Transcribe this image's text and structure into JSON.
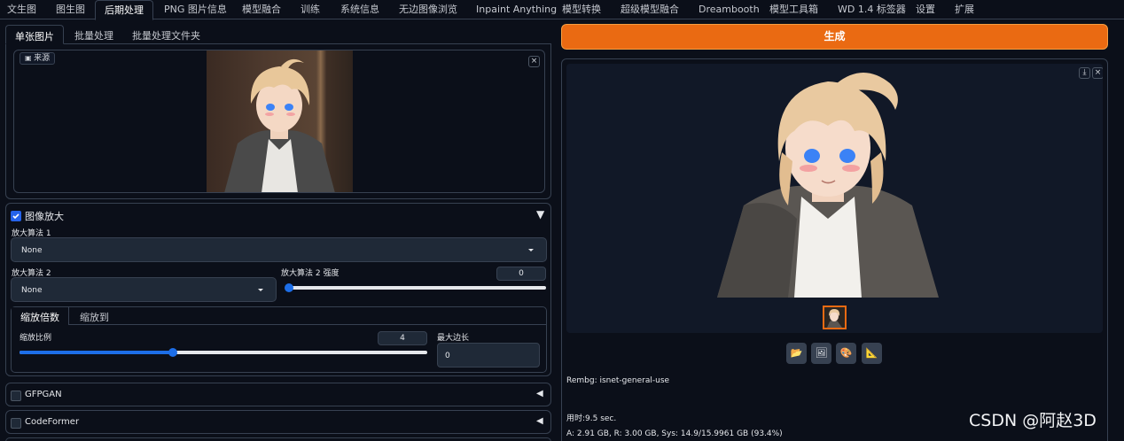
{
  "top_tabs": [
    {
      "label": "文生图",
      "active": false
    },
    {
      "label": "图生图",
      "active": false
    },
    {
      "label": "后期处理",
      "active": true
    },
    {
      "label": "PNG 图片信息",
      "active": false
    },
    {
      "label": "模型融合",
      "active": false
    },
    {
      "label": "训练",
      "active": false
    },
    {
      "label": "系统信息",
      "active": false
    },
    {
      "label": "无边图像浏览",
      "active": false
    },
    {
      "label": "Inpaint Anything",
      "active": false
    },
    {
      "label": "模型转换",
      "active": false
    },
    {
      "label": "超级模型融合",
      "active": false
    },
    {
      "label": "Dreambooth",
      "active": false
    },
    {
      "label": "模型工具箱",
      "active": false
    },
    {
      "label": "WD 1.4 标签器",
      "active": false
    },
    {
      "label": "设置",
      "active": false
    },
    {
      "label": "扩展",
      "active": false
    }
  ],
  "sub_tabs": [
    {
      "label": "单张图片",
      "active": true
    },
    {
      "label": "批量处理",
      "active": false
    },
    {
      "label": "批量处理文件夹",
      "active": false
    }
  ],
  "source": {
    "label": "来源",
    "close": "×"
  },
  "upscale": {
    "checked": true,
    "title": "图像放大",
    "upscaler1_label": "放大算法 1",
    "upscaler1_value": "None",
    "upscaler2_label": "放大算法 2",
    "upscaler2_value": "None",
    "upscaler2_strength_label": "放大算法 2 强度",
    "upscaler2_strength_value": "0",
    "upscaler2_strength_fraction": 0,
    "mode_tabs": [
      {
        "label": "缩放倍数",
        "active": true
      },
      {
        "label": "缩放到",
        "active": false
      }
    ],
    "scale_label": "缩放比例",
    "scale_value": "4",
    "scale_fraction": 0.375,
    "max_side_label": "最大边长",
    "max_side_value": "0",
    "collapse_glyph": "▼"
  },
  "gfpgan": {
    "title": "GFPGAN",
    "checked": false,
    "expand_glyph": "◀"
  },
  "codeformer": {
    "title": "CodeFormer",
    "checked": false,
    "expand_glyph": "◀"
  },
  "generate_label": "生成",
  "output": {
    "download": "⤓",
    "close": "×",
    "rembg_text": "Rembg: isnet-general-use",
    "time_text": "用时:9.5 sec.",
    "memory_text": "A: 2.91 GB, R: 3.00 GB, Sys: 14.9/15.9961 GB (93.4%)",
    "tool_buttons": [
      {
        "icon": "folder-icon",
        "glyph": "📂"
      },
      {
        "icon": "image-icon",
        "glyph": "🖼"
      },
      {
        "icon": "palette-icon",
        "glyph": "🎨"
      },
      {
        "icon": "ruler-icon",
        "glyph": "📐"
      }
    ]
  },
  "watermark": "CSDN @阿赵3D",
  "colors": {
    "accent": "#ea6a12",
    "background": "#0b0f19",
    "slider": "#1d6ee8"
  }
}
